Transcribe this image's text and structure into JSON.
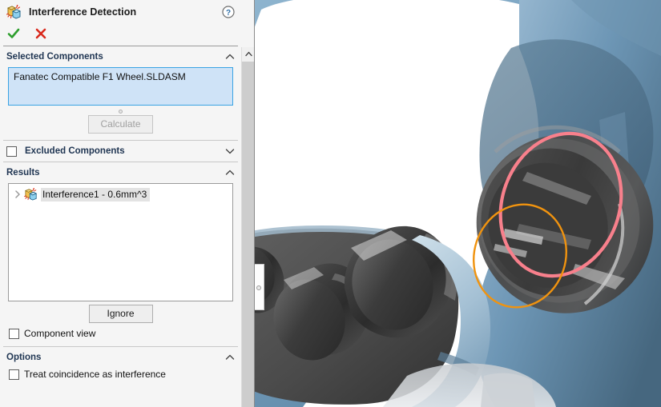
{
  "header": {
    "title": "Interference Detection",
    "icon": "interference-detection-icon",
    "help_icon": "help-icon",
    "accept_icon": "green-check-icon",
    "cancel_icon": "red-x-icon"
  },
  "selected_components": {
    "label": "Selected Components",
    "collapse_icon": "chevron-up-icon",
    "items": [
      "Fanatec Compatible F1 Wheel.SLDASM"
    ],
    "calculate_label": "Calculate",
    "calculate_enabled": false
  },
  "excluded_components": {
    "label": "Excluded Components",
    "checked": false,
    "collapse_icon": "chevron-down-icon"
  },
  "results": {
    "label": "Results",
    "collapse_icon": "chevron-up-icon",
    "tree": [
      {
        "label": "Interference1 - 0.6mm^3",
        "expand_icon": "chevron-right-icon",
        "item_icon": "interference-item-icon",
        "selected": true
      }
    ],
    "ignore_label": "Ignore",
    "component_view_label": "Component view",
    "component_view_checked": false
  },
  "options": {
    "label": "Options",
    "collapse_icon": "chevron-up-icon",
    "treat_coincidence_label": "Treat coincidence as interference",
    "treat_coincidence_checked": false
  },
  "scrollbar": {
    "up_arrow_icon": "scroll-up-arrow-icon"
  },
  "viewport": {
    "name": "3d-model-viewport",
    "colors": {
      "body_blue": "#7fa7c4",
      "body_blue_dark": "#4f7490",
      "metal_dark": "#3b3b3b",
      "interference_pink": "#f8808c",
      "interference_orange": "#f0930f",
      "background": "#ffffff"
    }
  }
}
